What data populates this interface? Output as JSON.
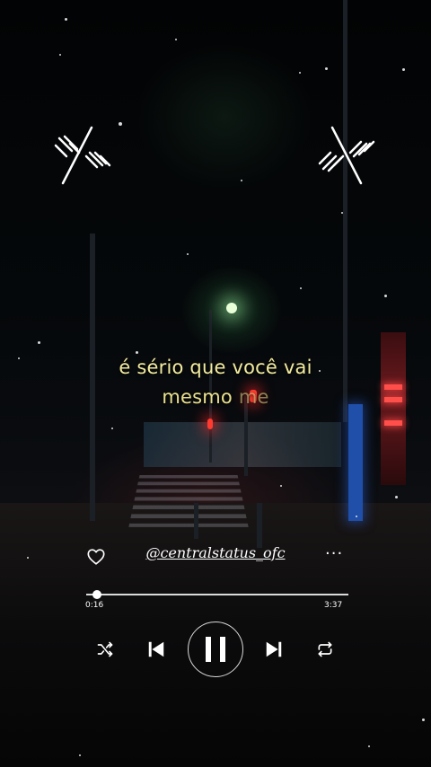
{
  "lyrics": {
    "line1": "é sério que você vai",
    "line2_main": "mesmo ",
    "line2_fade": "me"
  },
  "profile": {
    "username": "@centralstatus_ofc",
    "more_label": "···"
  },
  "player": {
    "current_time": "0:16",
    "total_time": "3:37",
    "progress_fraction": 0.04,
    "state": "playing"
  },
  "icons": {
    "heart": "heart-outline-icon",
    "shuffle": "shuffle-icon",
    "previous": "skip-previous-icon",
    "pause": "pause-icon",
    "next": "skip-next-icon",
    "repeat": "repeat-icon",
    "soundwave": "soundwave-icon"
  },
  "colors": {
    "lyric": "#f3ec9f",
    "text": "#ffffff"
  }
}
